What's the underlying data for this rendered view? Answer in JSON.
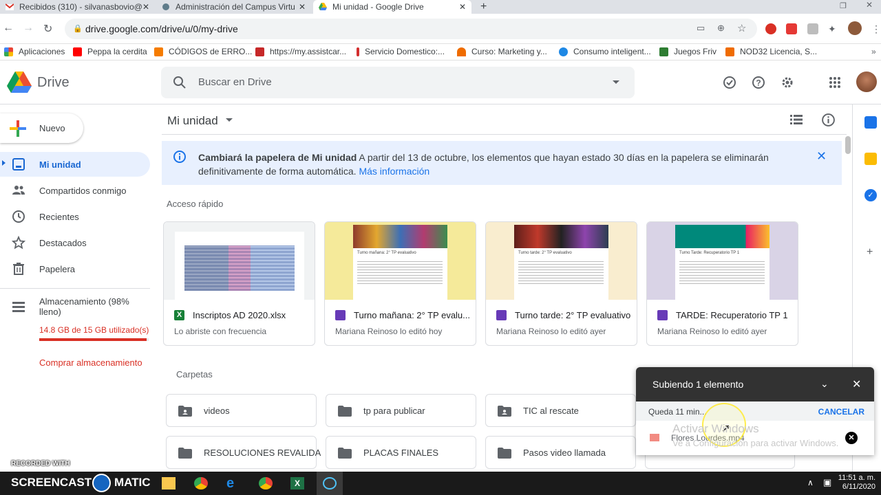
{
  "browser": {
    "tabs": [
      {
        "label": "Recibidos (310) - silvanasbovio@",
        "active": false
      },
      {
        "label": "Administración del Campus Virtu",
        "active": false
      },
      {
        "label": "Mi unidad - Google Drive",
        "active": true
      }
    ],
    "new_tab": "+",
    "url": "drive.google.com/drive/u/0/my-drive",
    "bookmarks": [
      "Aplicaciones",
      "Peppa la cerdita",
      "CÓDIGOS de ERRO...",
      "https://my.assistcar...",
      "Servicio Domestico:...",
      "Curso: Marketing y...",
      "Consumo inteligent...",
      "Juegos Friv",
      "NOD32 Licencia, S..."
    ]
  },
  "drive": {
    "logo_text": "Drive",
    "search_placeholder": "Buscar en Drive",
    "new_button": "Nuevo",
    "nav": [
      {
        "label": "Mi unidad",
        "selected": true
      },
      {
        "label": "Compartidos conmigo",
        "selected": false
      },
      {
        "label": "Recientes",
        "selected": false
      },
      {
        "label": "Destacados",
        "selected": false
      },
      {
        "label": "Papelera",
        "selected": false
      }
    ],
    "storage": {
      "label": "Almacenamiento (98% lleno)",
      "used": "14.8 GB de 15 GB utilizado(s)",
      "fraction": 0.98,
      "buy": "Comprar almacenamiento"
    },
    "breadcrumb": "Mi unidad",
    "banner": {
      "title": "Cambiará la papelera de Mi unidad",
      "body": "A partir del 13 de octubre, los elementos que hayan estado 30 días en la papelera se eliminarán definitivamente de forma automática.",
      "link": "Más información"
    },
    "quick_access_title": "Acceso rápido",
    "quick_access": [
      {
        "title": "Inscriptos AD 2020.xlsx",
        "sub": "Lo abriste con frecuencia",
        "type": "sheet"
      },
      {
        "title": "Turno mañana: 2° TP evalu...",
        "sub": "Mariana Reinoso lo editó hoy",
        "type": "form",
        "doc_title": "Turno mañana: 2° TP evaluativo"
      },
      {
        "title": "Turno tarde: 2° TP evaluativo",
        "sub": "Mariana Reinoso lo editó ayer",
        "type": "form",
        "doc_title": "Turno tarde: 2° TP evaluativo"
      },
      {
        "title": "TARDE: Recuperatorio TP 1",
        "sub": "Mariana Reinoso lo editó ayer",
        "type": "form",
        "doc_title": "Turno Tarde: Recuperatorio TP 1"
      }
    ],
    "folders_title": "Carpetas",
    "folders": [
      {
        "name": "videos",
        "shared": true
      },
      {
        "name": "tp para publicar",
        "shared": false
      },
      {
        "name": "TIC al rescate",
        "shared": true
      },
      {
        "name": "RESOLUCIONES REVALIDA",
        "shared": false
      },
      {
        "name": "PLACAS FINALES",
        "shared": false
      },
      {
        "name": "Pasos video llamada",
        "shared": false
      }
    ],
    "upload": {
      "title": "Subiendo 1 elemento",
      "remaining": "Queda 11 min...",
      "cancel": "CANCELAR",
      "file": "Flores Lourdes.mp4"
    }
  },
  "overlay": {
    "activate_windows": "Activar Windows",
    "activate_windows_sub": "Ve a Configuración para activar Windows.",
    "recorded_with": "RECORDED WITH",
    "screencast": "SCREENCAST",
    "matic": "MATIC"
  },
  "taskbar": {
    "time": "11:51 a. m.",
    "date": "6/11/2020"
  },
  "colors": {
    "selected_bg": "#e8f0fe",
    "selected_text": "#1967d2",
    "storage_bar": "#d93025",
    "link": "#1a73e8"
  }
}
